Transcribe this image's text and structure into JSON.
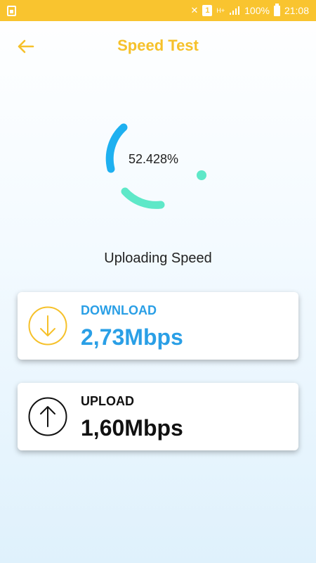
{
  "status_bar": {
    "battery_percent": "100%",
    "time": "21:08",
    "sim_label": "1",
    "network_label": "H+"
  },
  "header": {
    "title": "Speed Test"
  },
  "test": {
    "progress": "52.428%",
    "status": "Uploading Speed"
  },
  "results": {
    "download": {
      "label": "DOWNLOAD",
      "value": "2,73Mbps"
    },
    "upload": {
      "label": "UPLOAD",
      "value": "1,60Mbps"
    }
  },
  "colors": {
    "accent_yellow": "#f9c42f",
    "download_blue": "#2a9fe6",
    "ring_blue": "#1eb0f0",
    "ring_teal": "#5ee8c8"
  },
  "icons": {
    "back": "arrow-left-icon",
    "download": "arrow-down-circle-icon",
    "upload": "arrow-up-circle-icon"
  }
}
